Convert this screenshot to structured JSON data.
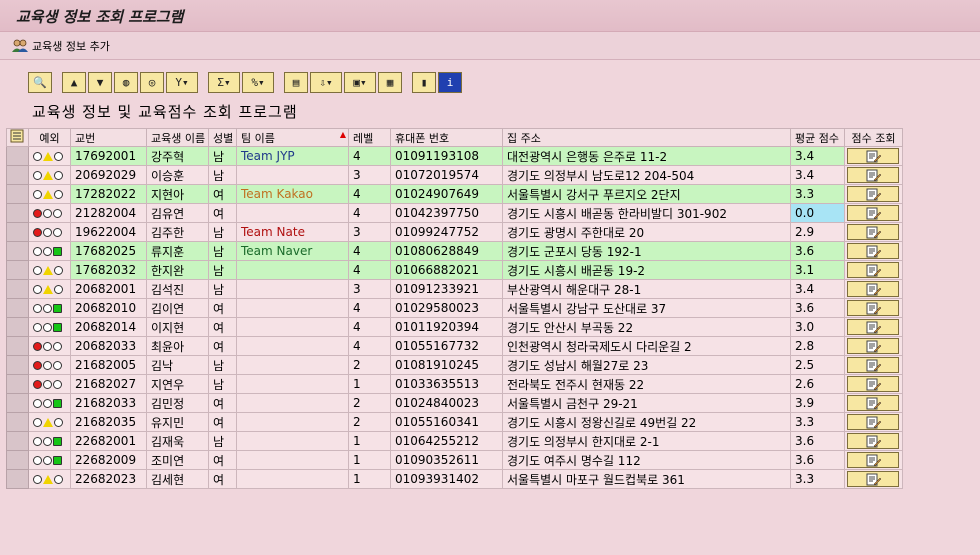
{
  "window": {
    "title": "교육생 정보 조회 프로그램"
  },
  "appbar": {
    "add_label": "교육생 정보 추가"
  },
  "heading": "교육생 정보 및 교육점수 조회 프로그램",
  "toolbar": {
    "buttons": [
      "magnifier",
      "print",
      "filter-top",
      "find",
      "find-next",
      "filter",
      "sum",
      "subtotal",
      "print-preview",
      "export",
      "layout",
      "grid",
      "chart",
      "info"
    ]
  },
  "table": {
    "headers": {
      "status": "예외",
      "id": "교번",
      "name": "교육생 이름",
      "gender": "성별",
      "team": "팀 이름",
      "level": "레벨",
      "phone": "휴대폰 번호",
      "address": "집 주소",
      "score": "평균 점수",
      "lookup": "점수 조회"
    },
    "rows": [
      {
        "lamp": "yellow",
        "id": "17692001",
        "name": "강주혁",
        "gender": "남",
        "team": "Team JYP",
        "level": "4",
        "phone": "01091193108",
        "address": "대전광역시 은행동 은주로 11-2",
        "score": "3.4",
        "color": "green"
      },
      {
        "lamp": "yellow",
        "id": "20692029",
        "name": "이승훈",
        "gender": "남",
        "team": "",
        "level": "3",
        "phone": "01072019574",
        "address": "경기도 의정부시 남도로12 204-504",
        "score": "3.4",
        "color": "pink"
      },
      {
        "lamp": "yellow",
        "id": "17282022",
        "name": "지현아",
        "gender": "여",
        "team": "Team Kakao",
        "level": "4",
        "phone": "01024907649",
        "address": "서울특별시 강서구 푸르지오 2단지",
        "score": "3.3",
        "color": "green"
      },
      {
        "lamp": "red",
        "id": "21282004",
        "name": "김유연",
        "gender": "여",
        "team": "",
        "level": "4",
        "phone": "01042397750",
        "address": "경기도 시흥시 배곧동 한라비발디 301-902",
        "score": "0.0",
        "color": "pink",
        "blue": true
      },
      {
        "lamp": "red",
        "id": "19622004",
        "name": "김주한",
        "gender": "남",
        "team": "Team Nate",
        "level": "3",
        "phone": "01099247752",
        "address": "경기도 광명시 주한대로 20",
        "score": "2.9",
        "color": "pink"
      },
      {
        "lamp": "green",
        "id": "17682025",
        "name": "류지훈",
        "gender": "남",
        "team": "Team Naver",
        "level": "4",
        "phone": "01080628849",
        "address": "경기도 군포시 당동 192-1",
        "score": "3.6",
        "color": "green"
      },
      {
        "lamp": "yellow",
        "id": "17682032",
        "name": "한지완",
        "gender": "남",
        "team": "",
        "level": "4",
        "phone": "01066882021",
        "address": "경기도 시흥시 배곧동 19-2",
        "score": "3.1",
        "color": "green"
      },
      {
        "lamp": "yellow",
        "id": "20682001",
        "name": "김석진",
        "gender": "남",
        "team": "",
        "level": "3",
        "phone": "01091233921",
        "address": "부산광역시 해운대구 28-1",
        "score": "3.4",
        "color": "pink"
      },
      {
        "lamp": "green",
        "id": "20682010",
        "name": "김이연",
        "gender": "여",
        "team": "",
        "level": "4",
        "phone": "01029580023",
        "address": "서울특별시 강남구 도산대로 37",
        "score": "3.6",
        "color": "pink"
      },
      {
        "lamp": "green",
        "id": "20682014",
        "name": "이지현",
        "gender": "여",
        "team": "",
        "level": "4",
        "phone": "01011920394",
        "address": "경기도 안산시 부곡동 22",
        "score": "3.0",
        "color": "pink"
      },
      {
        "lamp": "red",
        "id": "20682033",
        "name": "최윤아",
        "gender": "여",
        "team": "",
        "level": "4",
        "phone": "01055167732",
        "address": "인천광역시 청라국제도시 다리운길 2",
        "score": "2.8",
        "color": "pink"
      },
      {
        "lamp": "red",
        "id": "21682005",
        "name": "김낙",
        "gender": "남",
        "team": "",
        "level": "2",
        "phone": "01081910245",
        "address": "경기도 성남시 해월27로 23",
        "score": "2.5",
        "color": "pink"
      },
      {
        "lamp": "red",
        "id": "21682027",
        "name": "지연우",
        "gender": "남",
        "team": "",
        "level": "1",
        "phone": "01033635513",
        "address": "전라북도 전주시 현재동 22",
        "score": "2.6",
        "color": "pink"
      },
      {
        "lamp": "green",
        "id": "21682033",
        "name": "김민정",
        "gender": "여",
        "team": "",
        "level": "2",
        "phone": "01024840023",
        "address": "서울특별시 금천구 29-21",
        "score": "3.9",
        "color": "pink"
      },
      {
        "lamp": "yellow",
        "id": "21682035",
        "name": "유지민",
        "gender": "여",
        "team": "",
        "level": "2",
        "phone": "01055160341",
        "address": "경기도 시흥시 정왕신길로 49번길 22",
        "score": "3.3",
        "color": "pink"
      },
      {
        "lamp": "green",
        "id": "22682001",
        "name": "김재욱",
        "gender": "남",
        "team": "",
        "level": "1",
        "phone": "01064255212",
        "address": "경기도 의정부시 한지대로 2-1",
        "score": "3.6",
        "color": "pink"
      },
      {
        "lamp": "green",
        "id": "22682009",
        "name": "조미연",
        "gender": "여",
        "team": "",
        "level": "1",
        "phone": "01090352611",
        "address": "경기도 여주시 명수길 112",
        "score": "3.6",
        "color": "pink"
      },
      {
        "lamp": "yellow",
        "id": "22682023",
        "name": "김세현",
        "gender": "여",
        "team": "",
        "level": "1",
        "phone": "01093931402",
        "address": "서울특별시 마포구 월드컵북로 361",
        "score": "3.3",
        "color": "pink"
      }
    ]
  }
}
